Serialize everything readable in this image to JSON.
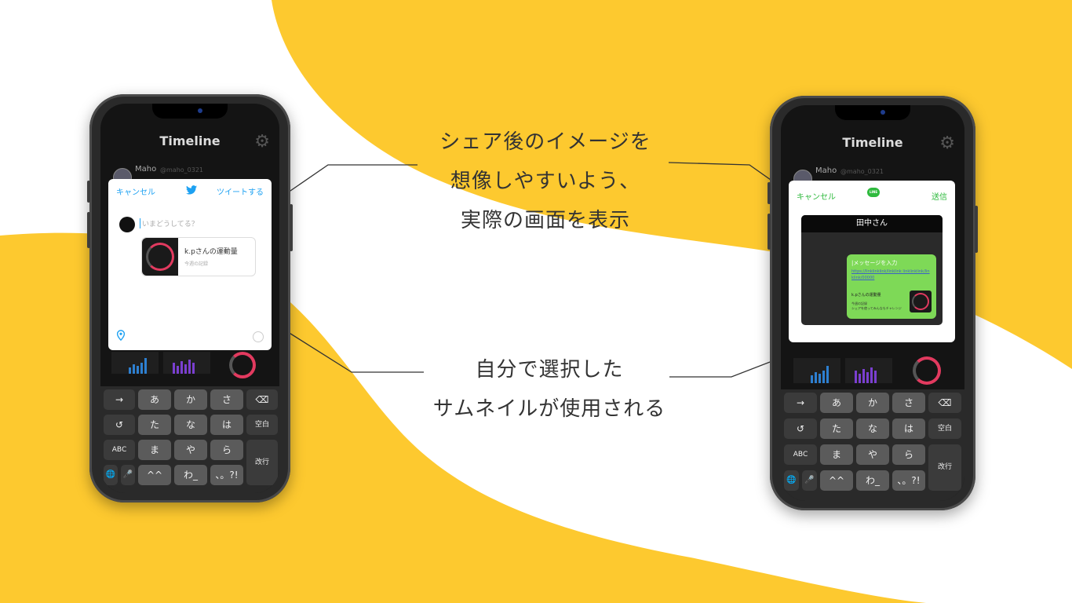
{
  "captions": {
    "top_lines": [
      "シェア後のイメージを",
      "想像しやすいよう、",
      "実際の画面を表示"
    ],
    "bottom_lines": [
      "自分で選択した",
      "サムネイルが使用される"
    ]
  },
  "colors": {
    "yellow": "#fdc92f",
    "twitter_blue": "#1da1f2",
    "line_green": "#2fba3e",
    "bubble_green": "#7ed957",
    "ring_pink": "#e23a5f"
  },
  "timeline": {
    "title": "Timeline",
    "user_name": "Maho",
    "user_handle": "@maho_0321",
    "gear_icon": "gear-icon"
  },
  "twitter_sheet": {
    "cancel": "キャンセル",
    "tweet_button": "ツイートする",
    "placeholder": "いまどうしてる？",
    "card_title": "k.pさんの運動量",
    "card_sub": "今週の記録",
    "icons": [
      "twitter-bird-icon",
      "location-pin-icon",
      "char-count-circle-icon"
    ]
  },
  "line_sheet": {
    "cancel": "キャンセル",
    "send": "送信",
    "logo_text": "LINE",
    "chat_header": "田中さん",
    "message_placeholder": "|メッセージを入力",
    "link_text": "https://linklinklink/linklink linklinklink/linklink/00000",
    "card_title": "k.pさんの運動量",
    "card_sub1": "今週の記録",
    "card_sub2": "シェアを使ってみんなもチャレンジ"
  },
  "keyboard": {
    "row1": [
      "→",
      "あ",
      "か",
      "さ",
      "⌫"
    ],
    "row2": [
      "↺",
      "た",
      "な",
      "は",
      "空白"
    ],
    "row3": [
      "ABC",
      "ま",
      "や",
      "ら",
      "改行"
    ],
    "row4": [
      "🌐",
      "🎤",
      "^^",
      "わ_",
      "、。?!"
    ]
  }
}
